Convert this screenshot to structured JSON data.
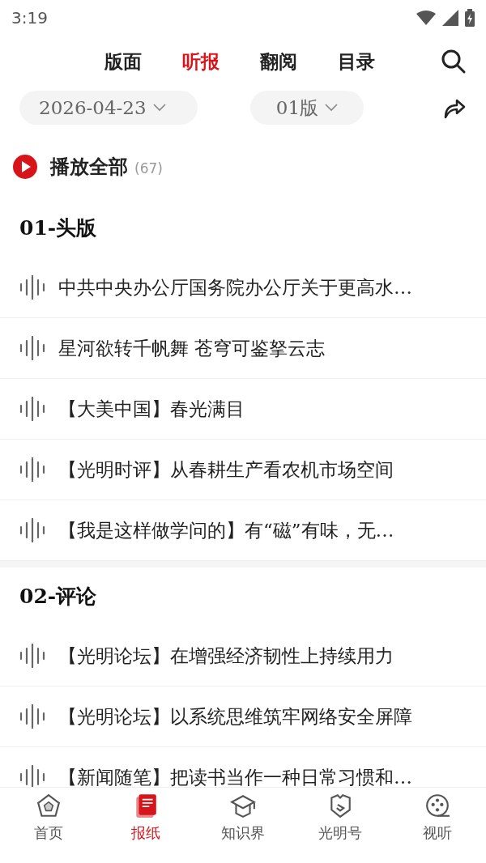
{
  "status_bar": {
    "time": "3:19"
  },
  "tabs": [
    {
      "label": "版面",
      "selected": false
    },
    {
      "label": "听报",
      "selected": true
    },
    {
      "label": "翻阅",
      "selected": false
    },
    {
      "label": "目录",
      "selected": false
    }
  ],
  "filters": {
    "date": "2026-04-23",
    "edition": "01版"
  },
  "play_all": {
    "label": "播放全部",
    "count": "(67)"
  },
  "sections": [
    {
      "title": "01-头版",
      "items": [
        "中共中央办公厅国务院办公厅关于更高水…",
        "星河欲转千帆舞  苍穹可鉴拏云志",
        "【大美中国】春光满目",
        "【光明时评】从春耕生产看农机市场空间",
        "【我是这样做学问的】有“磁”有味，无…"
      ]
    },
    {
      "title": "02-评论",
      "items": [
        "【光明论坛】在增强经济韧性上持续用力",
        "【光明论坛】以系统思维筑牢网络安全屏障",
        "【新闻随笔】把读书当作一种日常习惯和…"
      ]
    }
  ],
  "bottom_nav": [
    {
      "label": "首页",
      "kind": "home",
      "selected": false
    },
    {
      "label": "报纸",
      "kind": "paper",
      "selected": true
    },
    {
      "label": "知识界",
      "kind": "cap",
      "selected": false
    },
    {
      "label": "光明号",
      "kind": "shield",
      "selected": false
    },
    {
      "label": "视听",
      "kind": "film",
      "selected": false
    }
  ]
}
